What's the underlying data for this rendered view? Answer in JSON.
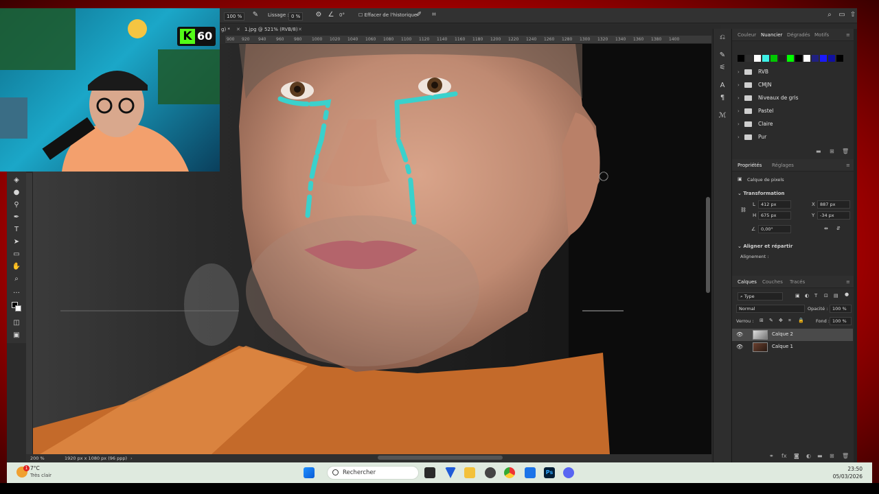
{
  "app": {
    "options_bar": {
      "zoom_select": "100 %",
      "smoothing_label": "Lissage :",
      "smoothing_value": "0 %",
      "angle_value": "0°",
      "history_label": "Effacer de l'historique"
    },
    "tabs": [
      {
        "label": "1.jpg @ 521% (RVB/8)"
      }
    ],
    "ruler_ticks": [
      "900",
      "920",
      "940",
      "960",
      "980",
      "1000",
      "1020",
      "1040",
      "1060",
      "1080",
      "1100",
      "1120",
      "1140",
      "1160",
      "1180",
      "1200",
      "1220",
      "1240",
      "1260",
      "1280",
      "1300",
      "1320",
      "1340",
      "1360",
      "1380",
      "1400"
    ],
    "status": {
      "zoom": "200 %",
      "doc_info": "1920 px x 1080 px (96 ppp)"
    }
  },
  "swatches_panel": {
    "tabs": [
      "Couleur",
      "Nuancier",
      "Dégradés",
      "Motifs"
    ],
    "active_tab": "Nuancier",
    "swatch_colors": [
      "#000000",
      "#303030",
      "#ffffff",
      "#3cf0e6",
      "#00c800",
      "#202020",
      "#00ff00",
      "#000000",
      "#ffffff",
      "#202080",
      "#1a1aff",
      "#1010a0",
      "#000000"
    ],
    "folders": [
      "RVB",
      "CMJN",
      "Niveaux de gris",
      "Pastel",
      "Claire",
      "Pur"
    ]
  },
  "properties_panel": {
    "tabs": [
      "Propriétés",
      "Réglages"
    ],
    "active_tab": "Propriétés",
    "layer_type": "Calque de pixels",
    "transform_title": "Transformation",
    "L_label": "L",
    "L_value": "412 px",
    "H_label": "H",
    "H_value": "675 px",
    "X_label": "X",
    "X_value": "887 px",
    "Y_label": "Y",
    "Y_value": "-34 px",
    "angle_value": "0,00°",
    "align_title": "Aligner et répartir",
    "align_label": "Alignement :"
  },
  "layers_panel": {
    "tabs": [
      "Calques",
      "Couches",
      "Tracés"
    ],
    "active_tab": "Calques",
    "filter_type": "Type",
    "blend_mode": "Normal",
    "opacity_label": "Opacité :",
    "opacity_value": "100 %",
    "lock_label": "Verrou :",
    "fill_label": "Fond :",
    "fill_value": "100 %",
    "layers": [
      {
        "name": "Calque 2",
        "selected": true
      },
      {
        "name": "Calque 1",
        "selected": false
      }
    ]
  },
  "overlay": {
    "badge_letter": "K",
    "badge_number": "60",
    "badge_color": "#53fc18"
  },
  "taskbar": {
    "weather_temp": "7°C",
    "weather_desc": "Très clair",
    "weather_badge": "1",
    "search_placeholder": "Rechercher",
    "time": "23:50",
    "date": "05/03/2026"
  }
}
